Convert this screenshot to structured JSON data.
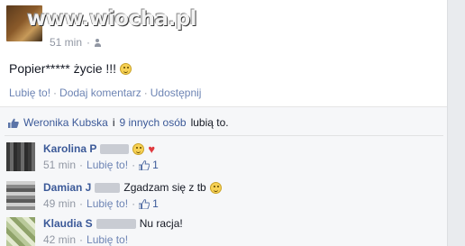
{
  "post": {
    "time": "51 min",
    "audience_icon": "people-icon",
    "text": "Popier***** życie !!!",
    "actions": [
      "Lubię to!",
      "Dodaj komentarz",
      "Udostępnij"
    ]
  },
  "watermark": "www.wiocha.pl",
  "likes": {
    "person": "Weronika Kubska",
    "conjunction": "i",
    "others": "9 innych osób",
    "suffix": "lubią to."
  },
  "comments": [
    {
      "author": "Karolina P",
      "text": "",
      "time": "51 min",
      "like_label": "Lubię to!",
      "like_count": "1",
      "has_emoji": true,
      "has_heart": true
    },
    {
      "author": "Damian J",
      "text": "Zgadzam się z tb",
      "time": "49 min",
      "like_label": "Lubię to!",
      "like_count": "1",
      "has_emoji": true,
      "has_heart": false
    },
    {
      "author": "Klaudia S",
      "text": "Nu racja!",
      "time": "42 min",
      "like_label": "Lubię to!",
      "like_count": "",
      "has_emoji": false,
      "has_heart": false
    }
  ],
  "colors": {
    "link": "#3b5998",
    "muted": "#9197a3",
    "feedback_bg": "#f6f7f9"
  }
}
